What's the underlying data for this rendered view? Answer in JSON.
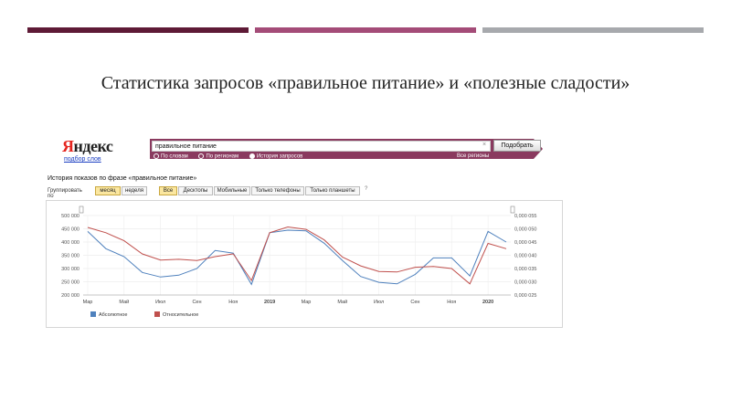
{
  "slide": {
    "accent_colors": [
      "#5e1a36",
      "#a44c78",
      "#a7a9ad"
    ],
    "title": "Статистика запросов «правильное питание» и «полезные сладости»"
  },
  "header": {
    "logo_first": "Я",
    "logo_rest": "ндекс",
    "logo_sub": "подбор слов",
    "search_value": "правильное питание",
    "clear_icon": "×",
    "search_button": "Подобрать",
    "radio_options": [
      "По словам",
      "По регионам",
      "История запросов"
    ],
    "radio_selected": 2,
    "all_regions": "Все регионы"
  },
  "history": {
    "title": "История показов по фразе «правильное питание»",
    "group_label": "Группировать по",
    "period_month": "месяц",
    "period_week": "неделя",
    "devices": [
      "Все",
      "Десктопы",
      "Мобильные",
      "Только телефоны",
      "Только планшеты"
    ],
    "help": "?"
  },
  "chart_data": {
    "type": "line",
    "x": [
      "Мар",
      "Апр",
      "Май",
      "Июн",
      "Июл",
      "Авг",
      "Сен",
      "Окт",
      "Ноя",
      "Дек",
      "2019",
      "Фев",
      "Мар",
      "Апр",
      "Май",
      "Июн",
      "Июл",
      "Авг",
      "Сен",
      "Окт",
      "Ноя",
      "Дек",
      "2020",
      "Фев"
    ],
    "x_tick_labels": [
      "Мар",
      "Май",
      "Июл",
      "Сен",
      "Ноя",
      "2019",
      "Мар",
      "Май",
      "Июл",
      "Сен",
      "Ноя",
      "2020"
    ],
    "series": [
      {
        "name": "Абсолютное",
        "color": "#4f81bd",
        "axis": "left",
        "values": [
          440000,
          375000,
          345000,
          285000,
          268000,
          275000,
          300000,
          368000,
          358000,
          240000,
          435000,
          445000,
          442000,
          395000,
          330000,
          270000,
          248000,
          242000,
          278000,
          340000,
          340000,
          272000,
          440000,
          400000
        ]
      },
      {
        "name": "Относительное",
        "color": "#c0504d",
        "axis": "right",
        "values": [
          0.0505,
          0.0485,
          0.0455,
          0.0405,
          0.0382,
          0.0385,
          0.038,
          0.0395,
          0.0405,
          0.0305,
          0.0485,
          0.0507,
          0.0498,
          0.0458,
          0.0393,
          0.036,
          0.0339,
          0.0337,
          0.0355,
          0.0358,
          0.035,
          0.0292,
          0.0445,
          0.0425
        ]
      }
    ],
    "y_left_ticks": [
      "500 000",
      "450 000",
      "400 000",
      "350 000",
      "300 000",
      "250 000",
      "200 000"
    ],
    "y_right_ticks": [
      "0,000 055",
      "0,000 050",
      "0,000 045",
      "0,000 040",
      "0,000 035",
      "0,000 030",
      "0,000 025"
    ],
    "ylim_left": [
      200000,
      500000
    ],
    "ylim_right": [
      0.025,
      0.055
    ],
    "grid": true,
    "legend": "bottom-left"
  }
}
